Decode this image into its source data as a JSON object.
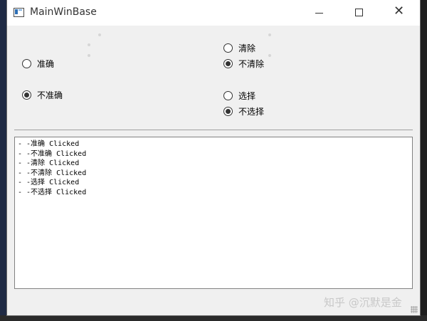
{
  "window": {
    "title": "MainWinBase"
  },
  "controls": {
    "minimize_icon": "minimize-icon",
    "maximize_icon": "maximize-icon",
    "close_icon": "close-icon",
    "close_glyph": "✕"
  },
  "radios": {
    "accurate": {
      "label": "准确",
      "checked": false
    },
    "not_accurate": {
      "label": "不准确",
      "checked": true
    },
    "clear": {
      "label": "清除",
      "checked": false
    },
    "not_clear": {
      "label": "不清除",
      "checked": true
    },
    "select": {
      "label": "选择",
      "checked": false
    },
    "not_select": {
      "label": "不选择",
      "checked": true
    }
  },
  "log": {
    "lines": [
      "- -准确 Clicked",
      "- -不准确 Clicked",
      "- -清除 Clicked",
      "- -不清除 Clicked",
      "- -选择 Clicked",
      "- -不选择 Clicked"
    ]
  },
  "watermark": {
    "text": "知乎 @沉默是金"
  }
}
